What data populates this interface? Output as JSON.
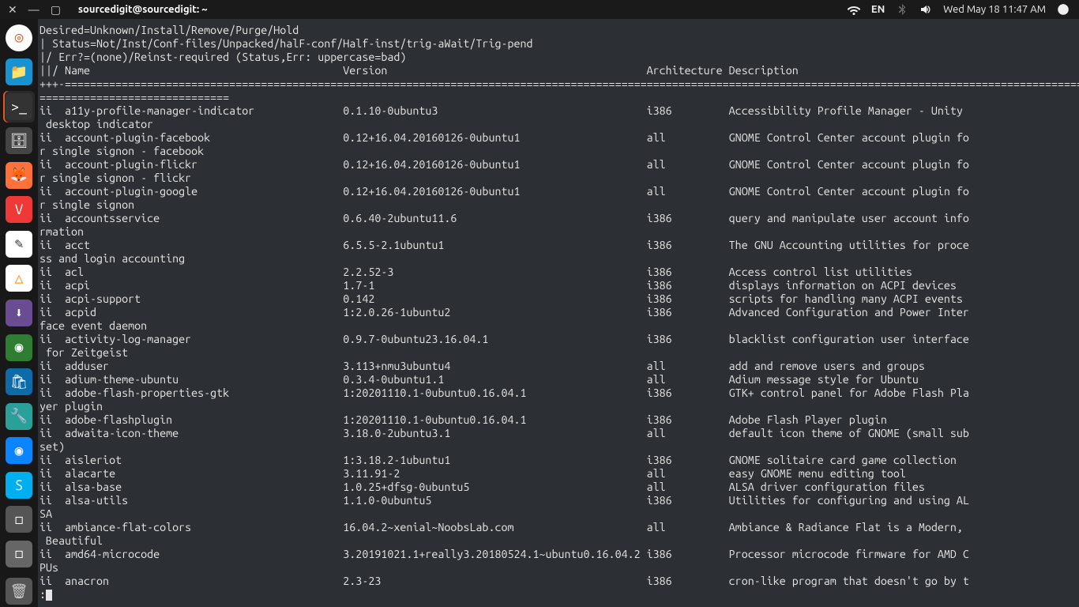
{
  "panel": {
    "window_controls": {
      "close": "✕",
      "min": "—",
      "max": "▢"
    },
    "title": "sourcedigit@sourcedigit: ~",
    "lang": "EN",
    "datetime": "Wed May 18 11:47 AM"
  },
  "dock": {
    "items": [
      {
        "name": "show-applications",
        "glyph": "◎",
        "cls": "tile-ubuntu"
      },
      {
        "name": "files",
        "glyph": "📁",
        "cls": "tile-files"
      },
      {
        "name": "terminal",
        "glyph": ">_",
        "cls": "tile-term",
        "active": true
      },
      {
        "name": "file-manager",
        "glyph": "🗄",
        "cls": "tile-file2"
      },
      {
        "name": "firefox",
        "glyph": "🦊",
        "cls": "tile-firefox"
      },
      {
        "name": "vivaldi",
        "glyph": "V",
        "cls": "tile-vivaldi"
      },
      {
        "name": "text-editor",
        "glyph": "✎",
        "cls": "tile-pencil"
      },
      {
        "name": "vlc",
        "glyph": "△",
        "cls": "tile-vlc"
      },
      {
        "name": "deb-installer",
        "glyph": "⬇",
        "cls": "tile-deb"
      },
      {
        "name": "screenshot",
        "glyph": "◉",
        "cls": "tile-screenshot"
      },
      {
        "name": "software",
        "glyph": "🛍",
        "cls": "tile-software"
      },
      {
        "name": "settings",
        "glyph": "🔧",
        "cls": "tile-wrench"
      },
      {
        "name": "app-spiral",
        "glyph": "◉",
        "cls": "tile-spiral"
      },
      {
        "name": "skype",
        "glyph": "S",
        "cls": "tile-skype"
      },
      {
        "name": "app-box-1",
        "glyph": "◻",
        "cls": "tile-box"
      },
      {
        "name": "app-box-2",
        "glyph": "◻",
        "cls": "tile-box2"
      }
    ],
    "trash": {
      "name": "trash",
      "glyph": "🗑",
      "cls": "tile-trash"
    }
  },
  "terminal": {
    "header_lines": [
      "Desired=Unknown/Install/Remove/Purge/Hold",
      "| Status=Not/Inst/Conf-files/Unpacked/halF-conf/Half-inst/trig-aWait/Trig-pend",
      "|/ Err?=(none)/Reinst-required (Status,Err: uppercase=bad)"
    ],
    "col_header": {
      "left": "||/ Name",
      "c1": "Version",
      "c2": "Architecture",
      "c3": "Description"
    },
    "separator": "+++-==================================================================================================================================================================",
    "packages": [
      {
        "n": "a11y-profile-manager-indicator",
        "v": "0.1.10-0ubuntu3",
        "a": "i386",
        "d": "Accessibility Profile Manager - Unity",
        "w": " desktop indicator"
      },
      {
        "n": "account-plugin-facebook",
        "v": "0.12+16.04.20160126-0ubuntu1",
        "a": "all",
        "d": "GNOME Control Center account plugin fo",
        "w": "r single signon - facebook"
      },
      {
        "n": "account-plugin-flickr",
        "v": "0.12+16.04.20160126-0ubuntu1",
        "a": "all",
        "d": "GNOME Control Center account plugin fo",
        "w": "r single signon - flickr"
      },
      {
        "n": "account-plugin-google",
        "v": "0.12+16.04.20160126-0ubuntu1",
        "a": "all",
        "d": "GNOME Control Center account plugin fo",
        "w": "r single signon"
      },
      {
        "n": "accountsservice",
        "v": "0.6.40-2ubuntu11.6",
        "a": "i386",
        "d": "query and manipulate user account info",
        "w": "rmation"
      },
      {
        "n": "acct",
        "v": "6.5.5-2.1ubuntu1",
        "a": "i386",
        "d": "The GNU Accounting utilities for proce",
        "w": "ss and login accounting"
      },
      {
        "n": "acl",
        "v": "2.2.52-3",
        "a": "i386",
        "d": "Access control list utilities"
      },
      {
        "n": "acpi",
        "v": "1.7-1",
        "a": "i386",
        "d": "displays information on ACPI devices"
      },
      {
        "n": "acpi-support",
        "v": "0.142",
        "a": "i386",
        "d": "scripts for handling many ACPI events"
      },
      {
        "n": "acpid",
        "v": "1:2.0.26-1ubuntu2",
        "a": "i386",
        "d": "Advanced Configuration and Power Inter",
        "w": "face event daemon"
      },
      {
        "n": "activity-log-manager",
        "v": "0.9.7-0ubuntu23.16.04.1",
        "a": "i386",
        "d": "blacklist configuration user interface",
        "w": " for Zeitgeist"
      },
      {
        "n": "adduser",
        "v": "3.113+nmu3ubuntu4",
        "a": "all",
        "d": "add and remove users and groups"
      },
      {
        "n": "adium-theme-ubuntu",
        "v": "0.3.4-0ubuntu1.1",
        "a": "all",
        "d": "Adium message style for Ubuntu"
      },
      {
        "n": "adobe-flash-properties-gtk",
        "v": "1:20201110.1-0ubuntu0.16.04.1",
        "a": "i386",
        "d": "GTK+ control panel for Adobe Flash Pla",
        "w": "yer plugin"
      },
      {
        "n": "adobe-flashplugin",
        "v": "1:20201110.1-0ubuntu0.16.04.1",
        "a": "i386",
        "d": "Adobe Flash Player plugin"
      },
      {
        "n": "adwaita-icon-theme",
        "v": "3.18.0-2ubuntu3.1",
        "a": "all",
        "d": "default icon theme of GNOME (small sub",
        "w": "set)"
      },
      {
        "n": "aisleriot",
        "v": "1:3.18.2-1ubuntu1",
        "a": "i386",
        "d": "GNOME solitaire card game collection"
      },
      {
        "n": "alacarte",
        "v": "3.11.91-2",
        "a": "all",
        "d": "easy GNOME menu editing tool"
      },
      {
        "n": "alsa-base",
        "v": "1.0.25+dfsg-0ubuntu5",
        "a": "all",
        "d": "ALSA driver configuration files"
      },
      {
        "n": "alsa-utils",
        "v": "1.1.0-0ubuntu5",
        "a": "i386",
        "d": "Utilities for configuring and using AL",
        "w": "SA"
      },
      {
        "n": "ambiance-flat-colors",
        "v": "16.04.2~xenial~NoobsLab.com",
        "a": "all",
        "d": "Ambiance & Radiance Flat is a Modern,",
        "w": " Beautiful"
      },
      {
        "n": "amd64-microcode",
        "v": "3.20191021.1+really3.20180524.1~ubuntu0.16.04.2",
        "a": "i386",
        "d": "Processor microcode firmware for AMD C",
        "w": "PUs"
      },
      {
        "n": "anacron",
        "v": "2.3-23",
        "a": "i386",
        "d": "cron-like program that doesn't go by t"
      }
    ],
    "prompt_prefix": ":"
  }
}
